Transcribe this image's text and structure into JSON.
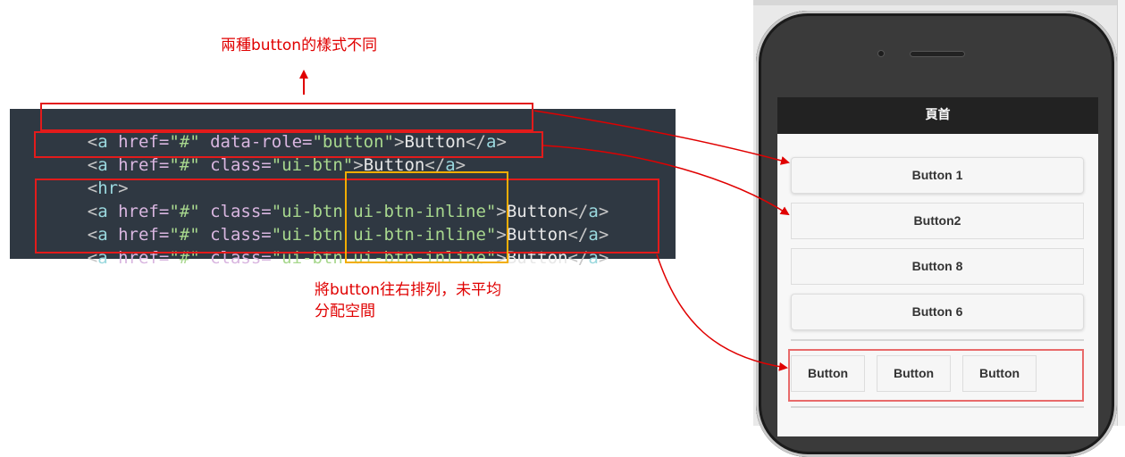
{
  "annotations": {
    "top_note": "兩種button的樣式不同",
    "bottom_note_line1": "將button往右排列，未平均",
    "bottom_note_line2": "分配空間"
  },
  "code": {
    "lines": [
      {
        "open": "<",
        "tag": "a",
        "attr": " href=",
        "attr_val": "\"#\"",
        "attr2": " data-role=",
        "attr2_val": "\"button\"",
        "close": ">",
        "text": "Button",
        "end_open": "</",
        "end_tag": "a",
        "end_close": ">"
      },
      {
        "open": "<",
        "tag": "a",
        "attr": " href=",
        "attr_val": "\"#\"",
        "attr2": " class=",
        "attr2_val": "\"ui-btn\"",
        "close": ">",
        "text": "Button",
        "end_open": "</",
        "end_tag": "a",
        "end_close": ">"
      },
      {
        "open": "<",
        "tag": "hr",
        "close": ">"
      },
      {
        "open": "<",
        "tag": "a",
        "attr": " href=",
        "attr_val": "\"#\"",
        "attr2": " class=",
        "attr2_val": "\"ui-btn ui-btn-inline\"",
        "close": ">",
        "text": "Button",
        "end_open": "</",
        "end_tag": "a",
        "end_close": ">"
      },
      {
        "open": "<",
        "tag": "a",
        "attr": " href=",
        "attr_val": "\"#\"",
        "attr2": " class=",
        "attr2_val": "\"ui-btn ui-btn-inline\"",
        "close": ">",
        "text": "Button",
        "end_open": "</",
        "end_tag": "a",
        "end_close": ">"
      },
      {
        "open": "<",
        "tag": "a",
        "attr": " href=",
        "attr_val": "\"#\"",
        "attr2": " class=",
        "attr2_val": "\"ui-btn ui-btn-inline\"",
        "close": ">",
        "text": "Button",
        "end_open": "</",
        "end_tag": "a",
        "end_close": ">"
      }
    ]
  },
  "phone": {
    "header_title": "頁首",
    "buttons": [
      "Button 1",
      "Button2",
      "Button 8",
      "Button 6"
    ],
    "inline_buttons": [
      "Button",
      "Button",
      "Button"
    ]
  },
  "colors": {
    "annotation_red": "#e00000",
    "highlight_yellow": "#f2ad00",
    "code_bg": "#2f3842",
    "header_bg": "#222222"
  }
}
